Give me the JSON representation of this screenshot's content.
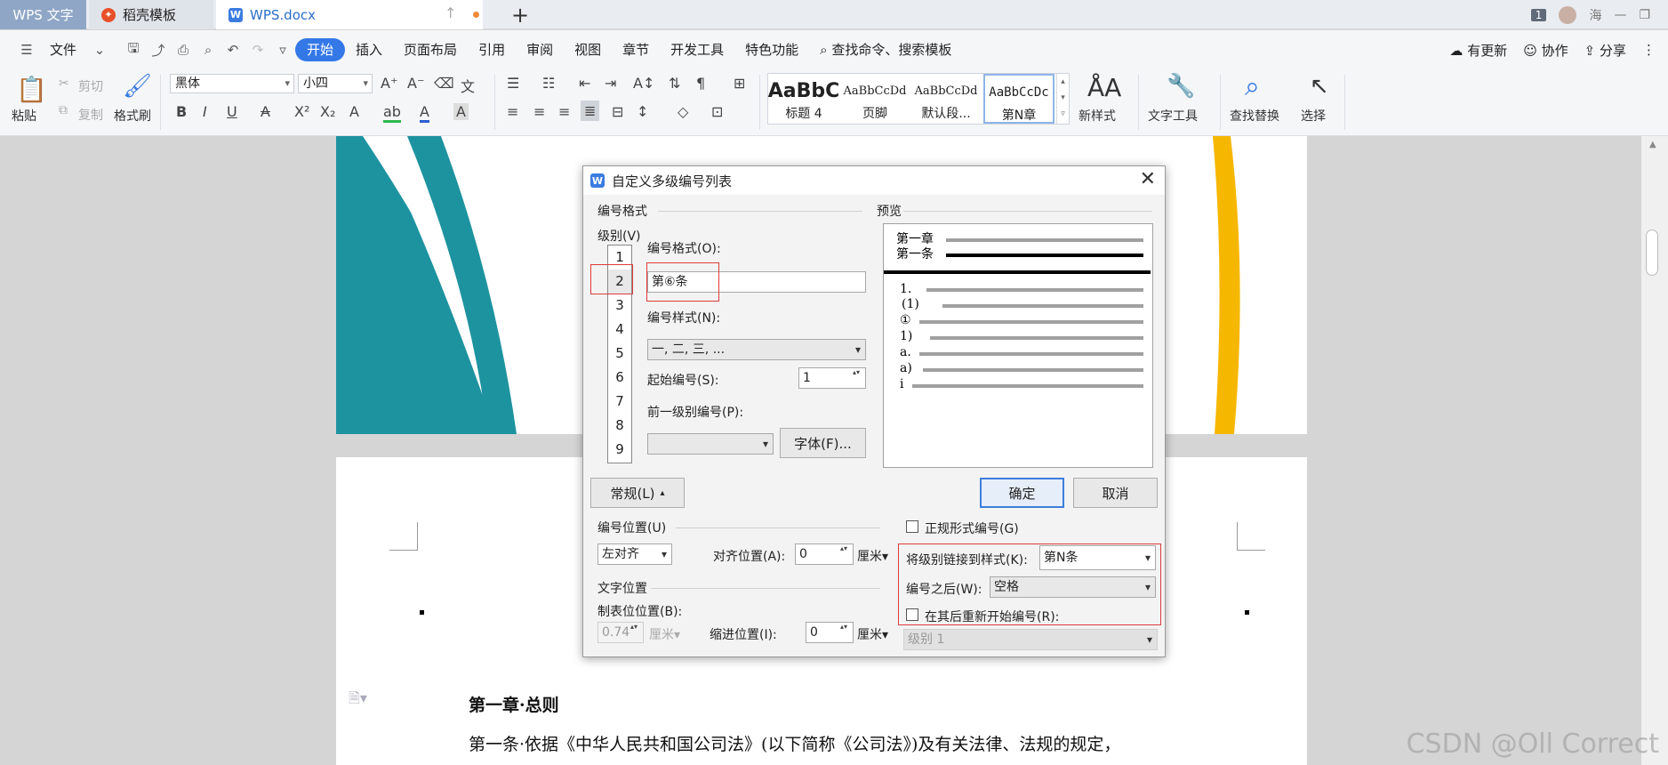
{
  "tabs": {
    "app": "WPS 文字",
    "template": "稻壳模板",
    "doc": "WPS.docx",
    "add": "+",
    "page_badge": "1",
    "user": "海"
  },
  "menu": {
    "file": "文件",
    "items": [
      "开始",
      "插入",
      "页面布局",
      "引用",
      "审阅",
      "视图",
      "章节",
      "开发工具",
      "特色功能"
    ],
    "search": "查找命令、搜索模板",
    "update": "有更新",
    "collab": "协作",
    "share": "分享"
  },
  "ribbon": {
    "paste": "粘贴",
    "cut": "剪切",
    "copy": "复制",
    "format_painter": "格式刷",
    "font": "黑体",
    "size": "小四",
    "styles": [
      {
        "sample": "AaBbC",
        "caption": "标题 4"
      },
      {
        "sample": "AaBbCcDd",
        "caption": "页脚"
      },
      {
        "sample": "AaBbCcDd",
        "caption": "默认段..."
      },
      {
        "sample": "AaBbCcDc",
        "caption": "第N章"
      }
    ],
    "new_style": "新样式",
    "text_tools": "文字工具",
    "find_replace": "查找替换",
    "select": "选择"
  },
  "document": {
    "heading": "第一章·总则",
    "para": "第一条·依据《中华人民共和国公司法》(以下简称《公司法》)及有关法律、法规的规定，",
    "watermark": "CSDN @Oll Correct"
  },
  "dialog": {
    "title": "自定义多级编号列表",
    "group_format": "编号格式",
    "group_preview": "预览",
    "level_label": "级别(V)",
    "levels": [
      "1",
      "2",
      "3",
      "4",
      "5",
      "6",
      "7",
      "8",
      "9"
    ],
    "number_format_label": "编号格式(O):",
    "number_format_value": "第⑥条",
    "number_style_label": "编号样式(N):",
    "number_style_value": "一, 二, 三, ...",
    "start_label": "起始编号(S):",
    "start_value": "1",
    "prev_level_label": "前一级别编号(P):",
    "font_button": "字体(F)...",
    "preview_labels": [
      "第一章",
      "第一条",
      "1.",
      "(1)",
      "①",
      "1)",
      "a.",
      "a)",
      "i"
    ],
    "normal_button": "常规(L)",
    "ok": "确定",
    "cancel": "取消",
    "legal_label": "正规形式编号(G)",
    "group_position": "编号位置(U)",
    "align_value": "左对齐",
    "align_pos_label": "对齐位置(A):",
    "align_pos_value": "0",
    "unit": "厘米",
    "group_text_position": "文字位置",
    "tab_label": "制表位位置(B):",
    "tab_value": "0.74",
    "indent_label": "缩进位置(I):",
    "indent_value": "0",
    "link_label": "将级别链接到样式(K):",
    "link_value": "第N条",
    "after_label": "编号之后(W):",
    "after_value": "空格",
    "restart_label": "在其后重新开始编号(R):",
    "restart_value": "级别 1"
  }
}
